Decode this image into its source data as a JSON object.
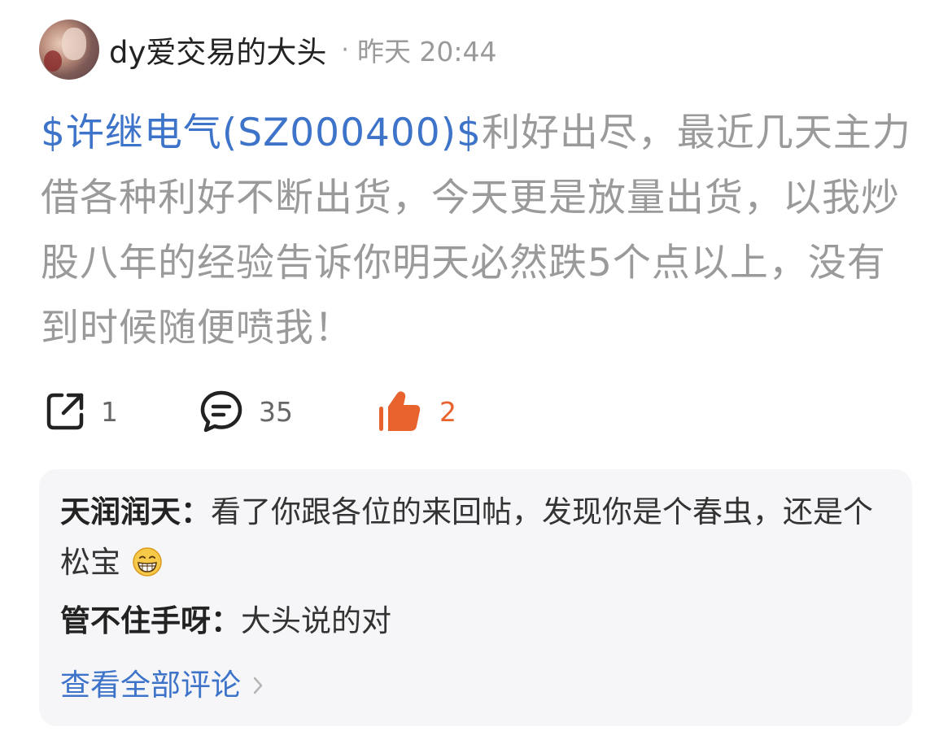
{
  "post": {
    "author": {
      "name": "dy爱交易的大头"
    },
    "separator": "·",
    "time": "昨天 20:44",
    "stock_tag": "$许继电气(SZ000400)$",
    "body": "利好出尽，最近几天主力借各种利好不断出货，今天更是放量出货，以我炒股八年的经验告诉你明天必然跌5个点以上，没有到时候随便喷我！"
  },
  "actions": {
    "share_count": "1",
    "comment_count": "35",
    "like_count": "2"
  },
  "comments": {
    "items": [
      {
        "author": "天润润天：",
        "text": "看了你跟各位的来回帖，发现你是个春虫，还是个松宝"
      },
      {
        "author": "管不住手呀：",
        "text": "大头说的对"
      }
    ],
    "view_all_label": "查看全部评论"
  },
  "colors": {
    "link": "#3d74c9",
    "muted_text": "#9a9a9a",
    "like_accent": "#e8622d",
    "comment_bg": "#f6f6f8"
  },
  "icons": {
    "share": "share-icon",
    "comment": "comment-bubble-icon",
    "like": "thumbs-up-icon",
    "emoji": "grinning-face-icon",
    "chevron": "chevron-right-icon"
  }
}
